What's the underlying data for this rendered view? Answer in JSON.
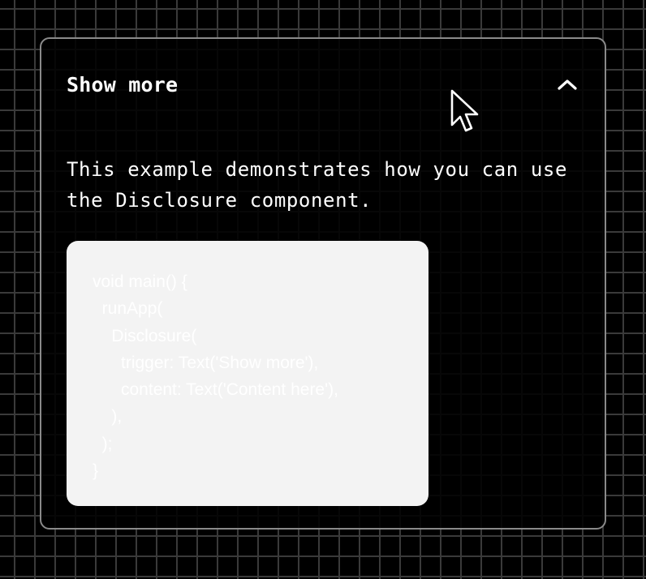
{
  "disclosure": {
    "trigger_label": "Show more",
    "expanded": true,
    "toggle_icon": "chevron-up-icon",
    "description": "This example demonstrates how you can use the Disclosure component.",
    "code_lines": [
      "void main() {",
      "  runApp(",
      "    Disclosure(",
      "      trigger: Text('Show more'),",
      "      content: Text('Content here'),",
      "    ),",
      "  );",
      "}"
    ]
  },
  "colors": {
    "background": "#000000",
    "grid_line": "#3a3a3a",
    "card_border": "#8a8a8a",
    "text": "#ffffff",
    "code_background": "#f3f3f3",
    "code_text": "#ffffff"
  },
  "pointer_icon": "mouse-pointer-icon"
}
